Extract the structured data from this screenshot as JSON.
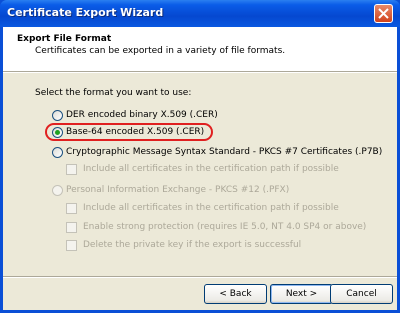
{
  "window": {
    "title": "Certificate Export Wizard"
  },
  "header": {
    "title": "Export File Format",
    "subtitle": "Certificates can be exported in a variety of file formats."
  },
  "main": {
    "prompt": "Select the format you want to use:",
    "options": [
      {
        "label": "DER encoded binary X.509 (.CER)",
        "selected": false,
        "enabled": true
      },
      {
        "label": "Base-64 encoded X.509 (.CER)",
        "selected": true,
        "enabled": true
      },
      {
        "label": "Cryptographic Message Syntax Standard - PKCS #7 Certificates (.P7B)",
        "selected": false,
        "enabled": true
      },
      {
        "label": "Personal Information Exchange - PKCS #12 (.PFX)",
        "selected": false,
        "enabled": false
      }
    ],
    "pkcs7_include_all": "Include all certificates in the certification path if possible",
    "pfx_include_all": "Include all certificates in the certification path if possible",
    "pfx_strong_protection": "Enable strong protection (requires IE 5.0, NT 4.0 SP4 or above)",
    "pfx_delete_key": "Delete the private key if the export is successful"
  },
  "footer": {
    "back": "< Back",
    "next": "Next >",
    "cancel": "Cancel"
  }
}
